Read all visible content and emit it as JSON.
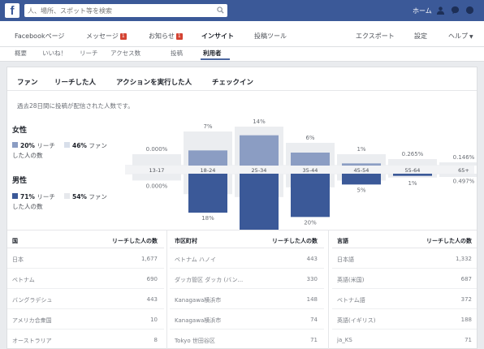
{
  "header": {
    "search_placeholder": "人、場所、スポット等を検索",
    "home_label": "ホーム",
    "brand_color": "#3b5998"
  },
  "page_tabs": {
    "facebook_page": "Facebookページ",
    "messages": "メッセージ",
    "messages_badge": "1",
    "notifications": "お知らせ",
    "notifications_badge": "1",
    "insights": "インサイト",
    "publishing_tools": "投稿ツール",
    "export": "エクスポート",
    "settings": "設定",
    "help": "ヘルプ"
  },
  "sub_tabs": [
    "概要",
    "いいね！",
    "リーチ",
    "アクセス数",
    "投稿",
    "利用者"
  ],
  "segment_tabs": [
    "ファン",
    "リーチした人",
    "アクションを実行した人",
    "チェックイン"
  ],
  "description": "過去28日間に投稿が配信された人数です。",
  "female": {
    "title": "女性",
    "reach_pct": "20%",
    "reach_label": "リーチ",
    "reach_sub": "した人の数",
    "fan_pct": "46%",
    "fan_label": "ファン"
  },
  "male": {
    "title": "男性",
    "reach_pct": "71%",
    "reach_label": "リーチ",
    "reach_sub": "した人の数",
    "fan_pct": "54%",
    "fan_label": "ファン"
  },
  "colors": {
    "female_reach": "#8b9dc3",
    "female_fan": "#d8dfea",
    "male_reach": "#3b5998",
    "male_fan": "#e6e8ec",
    "fan_bar": "#ebedf0",
    "reach_female_bar": "#8b9dc3",
    "reach_male_bar": "#3b5998"
  },
  "chart_data": {
    "type": "bar",
    "categories": [
      "13-17",
      "18-24",
      "25-34",
      "35-44",
      "45-54",
      "55-64",
      "65+"
    ],
    "series": [
      {
        "name": "女性",
        "values": [
          0.0,
          7,
          14,
          6,
          1,
          0.0,
          0.0
        ],
        "labels": [
          "0.000%",
          "7%",
          "14%",
          "6%",
          "1%",
          "0.265%",
          "0.146%"
        ]
      },
      {
        "name": "男性",
        "values": [
          0.0,
          18,
          27,
          20,
          5,
          1,
          0.0
        ],
        "labels": [
          "0.000%",
          "18%",
          "27%",
          "20%",
          "5%",
          "1%",
          "0.497%"
        ]
      }
    ],
    "ylim": [
      0,
      30
    ]
  },
  "table_country": {
    "header_name": "国",
    "header_value": "リーチした人の数",
    "rows": [
      {
        "name": "日本",
        "value": "1,677"
      },
      {
        "name": "ベトナム",
        "value": "690"
      },
      {
        "name": "バングラデシュ",
        "value": "443"
      },
      {
        "name": "アメリカ合衆国",
        "value": "10"
      },
      {
        "name": "オーストラリア",
        "value": "8"
      }
    ]
  },
  "table_city": {
    "header_name": "市区町村",
    "header_value": "リーチした人の数",
    "rows": [
      {
        "name": "ベトナム ハノイ",
        "value": "443"
      },
      {
        "name": "ダッカ管区 ダッカ (バン...",
        "value": "330"
      },
      {
        "name": "Kanagawa横浜市",
        "value": "148"
      },
      {
        "name": "Kanagawa横浜市",
        "value": "74"
      },
      {
        "name": "Tokyo 世田谷区",
        "value": "71"
      }
    ]
  },
  "table_language": {
    "header_name": "言語",
    "header_value": "リーチした人の数",
    "rows": [
      {
        "name": "日本語",
        "value": "1,332"
      },
      {
        "name": "英語(米国)",
        "value": "687"
      },
      {
        "name": "ベトナム語",
        "value": "372"
      },
      {
        "name": "英語(イギリス)",
        "value": "188"
      },
      {
        "name": "ja_KS",
        "value": "71"
      }
    ]
  }
}
